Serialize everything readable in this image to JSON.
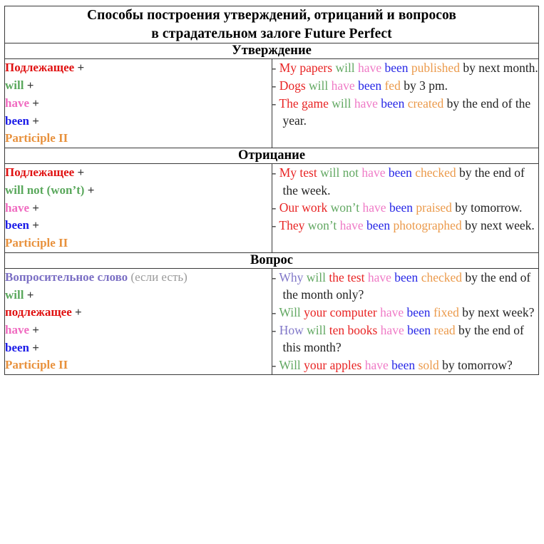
{
  "title": {
    "line1": "Способы построения утверждений, отрицаний и вопросов",
    "line2": "в страдательном залоге Future Perfect"
  },
  "colors": {
    "subject": "#e01111",
    "will": "#5aa85c",
    "have": "#f06bc0",
    "been": "#1c1ce8",
    "participle": "#e8913c",
    "question_word": "#7b6fc4",
    "note": "#9a9a9a",
    "plain_text": "#222222",
    "border": "#3a3a3a"
  },
  "sections": [
    {
      "heading": "Утверждение",
      "formula": [
        {
          "word": "Подлежащее",
          "role": "subject",
          "plus": " +"
        },
        {
          "word": "will",
          "role": "will",
          "plus": " +"
        },
        {
          "word": "have",
          "role": "have",
          "plus": " +"
        },
        {
          "word": "been",
          "role": "been",
          "plus": " +"
        },
        {
          "word": "Participle II",
          "role": "participle",
          "plus": ""
        }
      ],
      "examples": [
        {
          "dash": "-",
          "parts": [
            {
              "t": "My papers",
              "role": "subject"
            },
            {
              "t": " ",
              "role": "plain"
            },
            {
              "t": "will",
              "role": "will"
            },
            {
              "t": " ",
              "role": "plain"
            },
            {
              "t": "have",
              "role": "have"
            },
            {
              "t": " ",
              "role": "plain"
            },
            {
              "t": "been",
              "role": "been"
            },
            {
              "t": " ",
              "role": "plain"
            },
            {
              "t": "published",
              "role": "participle"
            },
            {
              "t": " by next month.",
              "role": "plain"
            }
          ]
        },
        {
          "dash": "-",
          "parts": [
            {
              "t": "Dogs",
              "role": "subject"
            },
            {
              "t": " ",
              "role": "plain"
            },
            {
              "t": "will",
              "role": "will"
            },
            {
              "t": " ",
              "role": "plain"
            },
            {
              "t": "have",
              "role": "have"
            },
            {
              "t": " ",
              "role": "plain"
            },
            {
              "t": "been",
              "role": "been"
            },
            {
              "t": " ",
              "role": "plain"
            },
            {
              "t": "fed",
              "role": "participle"
            },
            {
              "t": " by 3 pm.",
              "role": "plain"
            }
          ]
        },
        {
          "dash": "-",
          "parts": [
            {
              "t": "The game",
              "role": "subject"
            },
            {
              "t": " ",
              "role": "plain"
            },
            {
              "t": "will",
              "role": "will"
            },
            {
              "t": " ",
              "role": "plain"
            },
            {
              "t": "have",
              "role": "have"
            },
            {
              "t": " ",
              "role": "plain"
            },
            {
              "t": "been",
              "role": "been"
            },
            {
              "t": " ",
              "role": "plain"
            },
            {
              "t": "created",
              "role": "participle"
            },
            {
              "t": " by the end of the year.",
              "role": "plain"
            }
          ]
        }
      ]
    },
    {
      "heading": "Отрицание",
      "formula": [
        {
          "word": "Подлежащее",
          "role": "subject",
          "plus": " +"
        },
        {
          "word": "will not (won’t)",
          "role": "will",
          "plus": " +"
        },
        {
          "word": "have",
          "role": "have",
          "plus": " +"
        },
        {
          "word": "been",
          "role": "been",
          "plus": " +"
        },
        {
          "word": "Participle II",
          "role": "participle",
          "plus": ""
        }
      ],
      "examples": [
        {
          "dash": "-",
          "parts": [
            {
              "t": "My test",
              "role": "subject"
            },
            {
              "t": " ",
              "role": "plain"
            },
            {
              "t": "will not",
              "role": "will"
            },
            {
              "t": " ",
              "role": "plain"
            },
            {
              "t": "have",
              "role": "have"
            },
            {
              "t": " ",
              "role": "plain"
            },
            {
              "t": "been",
              "role": "been"
            },
            {
              "t": " ",
              "role": "plain"
            },
            {
              "t": "checked",
              "role": "participle"
            },
            {
              "t": " by the end of the week.",
              "role": "plain"
            }
          ]
        },
        {
          "dash": "-",
          "parts": [
            {
              "t": "Our work",
              "role": "subject"
            },
            {
              "t": " ",
              "role": "plain"
            },
            {
              "t": "won’t",
              "role": "will"
            },
            {
              "t": " ",
              "role": "plain"
            },
            {
              "t": "have",
              "role": "have"
            },
            {
              "t": " ",
              "role": "plain"
            },
            {
              "t": "been",
              "role": "been"
            },
            {
              "t": " ",
              "role": "plain"
            },
            {
              "t": "praised",
              "role": "participle"
            },
            {
              "t": " by tomorrow.",
              "role": "plain"
            }
          ]
        },
        {
          "dash": "-",
          "parts": [
            {
              "t": "They",
              "role": "subject"
            },
            {
              "t": " ",
              "role": "plain"
            },
            {
              "t": "won’t",
              "role": "will"
            },
            {
              "t": " ",
              "role": "plain"
            },
            {
              "t": "have",
              "role": "have"
            },
            {
              "t": " ",
              "role": "plain"
            },
            {
              "t": "been",
              "role": "been"
            },
            {
              "t": " ",
              "role": "plain"
            },
            {
              "t": "photographed",
              "role": "participle"
            },
            {
              "t": " by next week.",
              "role": "plain"
            }
          ]
        }
      ]
    },
    {
      "heading": "Вопрос",
      "formula": [
        {
          "word": "Вопросительное слово",
          "role": "question_word",
          "plus": "",
          "note": " (если есть)"
        },
        {
          "word": "will",
          "role": "will",
          "plus": " +"
        },
        {
          "word": "подлежащее",
          "role": "subject",
          "plus": " +"
        },
        {
          "word": "have",
          "role": "have",
          "plus": " +"
        },
        {
          "word": "been",
          "role": "been",
          "plus": " +"
        },
        {
          "word": "Participle II",
          "role": "participle",
          "plus": ""
        }
      ],
      "examples": [
        {
          "dash": "-",
          "parts": [
            {
              "t": "Why",
              "role": "question_word"
            },
            {
              "t": " ",
              "role": "plain"
            },
            {
              "t": "will",
              "role": "will"
            },
            {
              "t": " ",
              "role": "plain"
            },
            {
              "t": "the test",
              "role": "subject"
            },
            {
              "t": " ",
              "role": "plain"
            },
            {
              "t": "have",
              "role": "have"
            },
            {
              "t": " ",
              "role": "plain"
            },
            {
              "t": "been",
              "role": "been"
            },
            {
              "t": " ",
              "role": "plain"
            },
            {
              "t": "checked",
              "role": "participle"
            },
            {
              "t": " by the end of the month only?",
              "role": "plain"
            }
          ]
        },
        {
          "dash": "-",
          "parts": [
            {
              "t": "Will",
              "role": "will"
            },
            {
              "t": " ",
              "role": "plain"
            },
            {
              "t": "your computer",
              "role": "subject"
            },
            {
              "t": " ",
              "role": "plain"
            },
            {
              "t": "have",
              "role": "have"
            },
            {
              "t": " ",
              "role": "plain"
            },
            {
              "t": "been",
              "role": "been"
            },
            {
              "t": " ",
              "role": "plain"
            },
            {
              "t": "fixed",
              "role": "participle"
            },
            {
              "t": " by next week?",
              "role": "plain"
            }
          ]
        },
        {
          "dash": "-",
          "parts": [
            {
              "t": "How",
              "role": "question_word"
            },
            {
              "t": " ",
              "role": "plain"
            },
            {
              "t": "will",
              "role": "will"
            },
            {
              "t": " ",
              "role": "plain"
            },
            {
              "t": "ten books",
              "role": "subject"
            },
            {
              "t": " ",
              "role": "plain"
            },
            {
              "t": "have",
              "role": "have"
            },
            {
              "t": " ",
              "role": "plain"
            },
            {
              "t": "been",
              "role": "been"
            },
            {
              "t": " ",
              "role": "plain"
            },
            {
              "t": "read",
              "role": "participle"
            },
            {
              "t": " by the end of this month?",
              "role": "plain"
            }
          ]
        },
        {
          "dash": "-",
          "parts": [
            {
              "t": "Will",
              "role": "will"
            },
            {
              "t": " ",
              "role": "plain"
            },
            {
              "t": "your apples",
              "role": "subject"
            },
            {
              "t": " ",
              "role": "plain"
            },
            {
              "t": "have",
              "role": "have"
            },
            {
              "t": " ",
              "role": "plain"
            },
            {
              "t": "been",
              "role": "been"
            },
            {
              "t": " ",
              "role": "plain"
            },
            {
              "t": "sold",
              "role": "participle"
            },
            {
              "t": " by tomorrow?",
              "role": "plain"
            }
          ]
        }
      ]
    }
  ]
}
